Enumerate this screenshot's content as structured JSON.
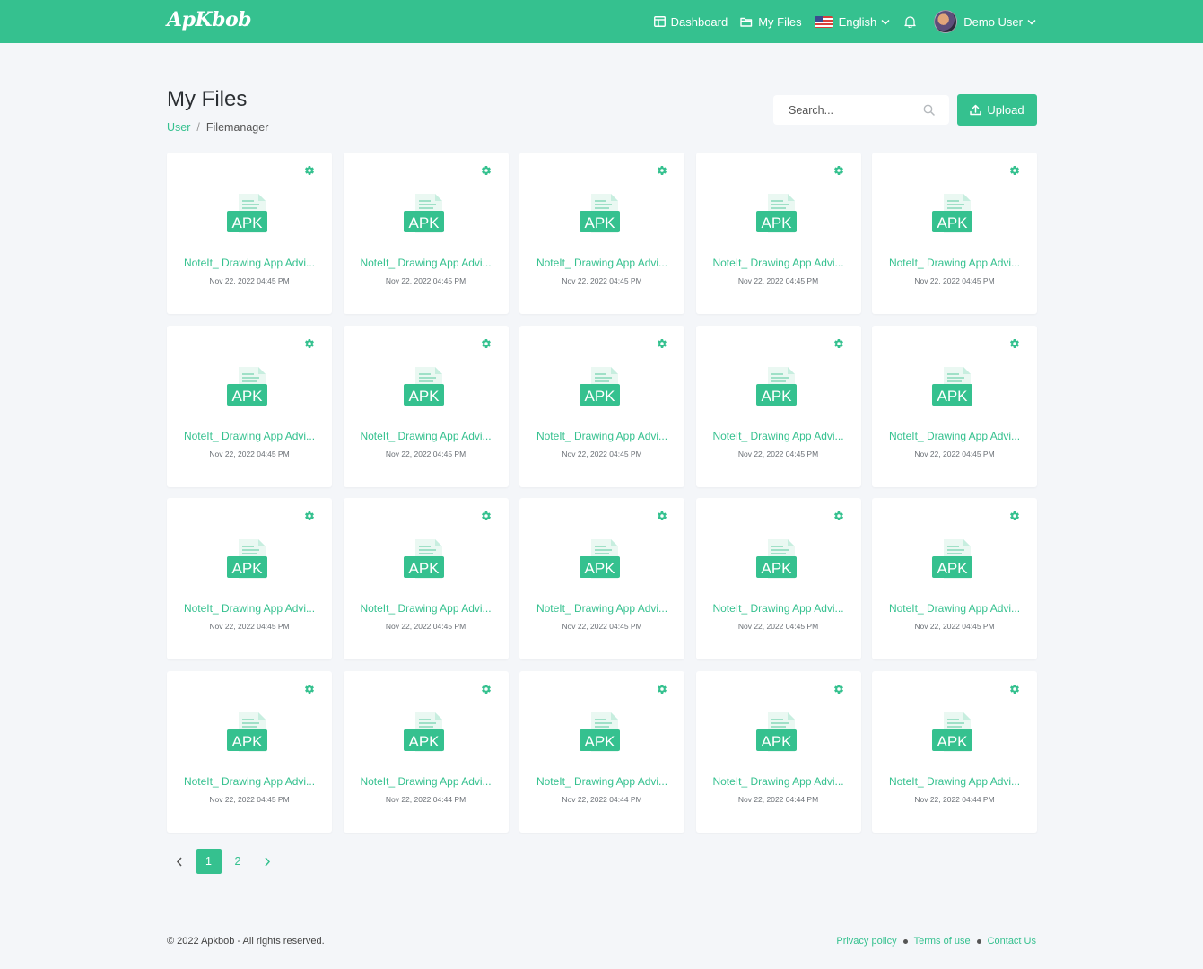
{
  "header": {
    "logo": "ApKbob",
    "nav": {
      "dashboard": "Dashboard",
      "my_files": "My Files",
      "language": "English",
      "user": "Demo User"
    }
  },
  "page": {
    "title": "My Files",
    "breadcrumb": {
      "root": "User",
      "separator": "/",
      "current": "Filemanager"
    },
    "search_placeholder": "Search...",
    "upload_label": "Upload"
  },
  "files": [
    {
      "name": "NoteIt_ Drawing App Advi...",
      "date": "Nov 22, 2022 04:45 PM",
      "badge": "APK"
    },
    {
      "name": "NoteIt_ Drawing App Advi...",
      "date": "Nov 22, 2022 04:45 PM",
      "badge": "APK"
    },
    {
      "name": "NoteIt_ Drawing App Advi...",
      "date": "Nov 22, 2022 04:45 PM",
      "badge": "APK"
    },
    {
      "name": "NoteIt_ Drawing App Advi...",
      "date": "Nov 22, 2022 04:45 PM",
      "badge": "APK"
    },
    {
      "name": "NoteIt_ Drawing App Advi...",
      "date": "Nov 22, 2022 04:45 PM",
      "badge": "APK"
    },
    {
      "name": "NoteIt_ Drawing App Advi...",
      "date": "Nov 22, 2022 04:45 PM",
      "badge": "APK"
    },
    {
      "name": "NoteIt_ Drawing App Advi...",
      "date": "Nov 22, 2022 04:45 PM",
      "badge": "APK"
    },
    {
      "name": "NoteIt_ Drawing App Advi...",
      "date": "Nov 22, 2022 04:45 PM",
      "badge": "APK"
    },
    {
      "name": "NoteIt_ Drawing App Advi...",
      "date": "Nov 22, 2022 04:45 PM",
      "badge": "APK"
    },
    {
      "name": "NoteIt_ Drawing App Advi...",
      "date": "Nov 22, 2022 04:45 PM",
      "badge": "APK"
    },
    {
      "name": "NoteIt_ Drawing App Advi...",
      "date": "Nov 22, 2022 04:45 PM",
      "badge": "APK"
    },
    {
      "name": "NoteIt_ Drawing App Advi...",
      "date": "Nov 22, 2022 04:45 PM",
      "badge": "APK"
    },
    {
      "name": "NoteIt_ Drawing App Advi...",
      "date": "Nov 22, 2022 04:45 PM",
      "badge": "APK"
    },
    {
      "name": "NoteIt_ Drawing App Advi...",
      "date": "Nov 22, 2022 04:45 PM",
      "badge": "APK"
    },
    {
      "name": "NoteIt_ Drawing App Advi...",
      "date": "Nov 22, 2022 04:45 PM",
      "badge": "APK"
    },
    {
      "name": "NoteIt_ Drawing App Advi...",
      "date": "Nov 22, 2022 04:45 PM",
      "badge": "APK"
    },
    {
      "name": "NoteIt_ Drawing App Advi...",
      "date": "Nov 22, 2022 04:44 PM",
      "badge": "APK"
    },
    {
      "name": "NoteIt_ Drawing App Advi...",
      "date": "Nov 22, 2022 04:44 PM",
      "badge": "APK"
    },
    {
      "name": "NoteIt_ Drawing App Advi...",
      "date": "Nov 22, 2022 04:44 PM",
      "badge": "APK"
    },
    {
      "name": "NoteIt_ Drawing App Advi...",
      "date": "Nov 22, 2022 04:44 PM",
      "badge": "APK"
    }
  ],
  "pagination": {
    "pages": [
      "1",
      "2"
    ],
    "current": "1"
  },
  "footer": {
    "copyright": "© 2022 Apkbob - All rights reserved.",
    "links": [
      "Privacy policy",
      "Terms of use",
      "Contact Us"
    ]
  },
  "icons": {
    "dashboard": "dashboard-icon",
    "files": "folder-icon",
    "language": "us-flag-icon",
    "notifications": "bell-icon",
    "search": "search-icon",
    "upload": "upload-icon",
    "file_settings": "gear-icon",
    "file_type": "apk-file-icon"
  },
  "colors": {
    "accent": "#35c18f",
    "background": "#f4f6f9"
  }
}
